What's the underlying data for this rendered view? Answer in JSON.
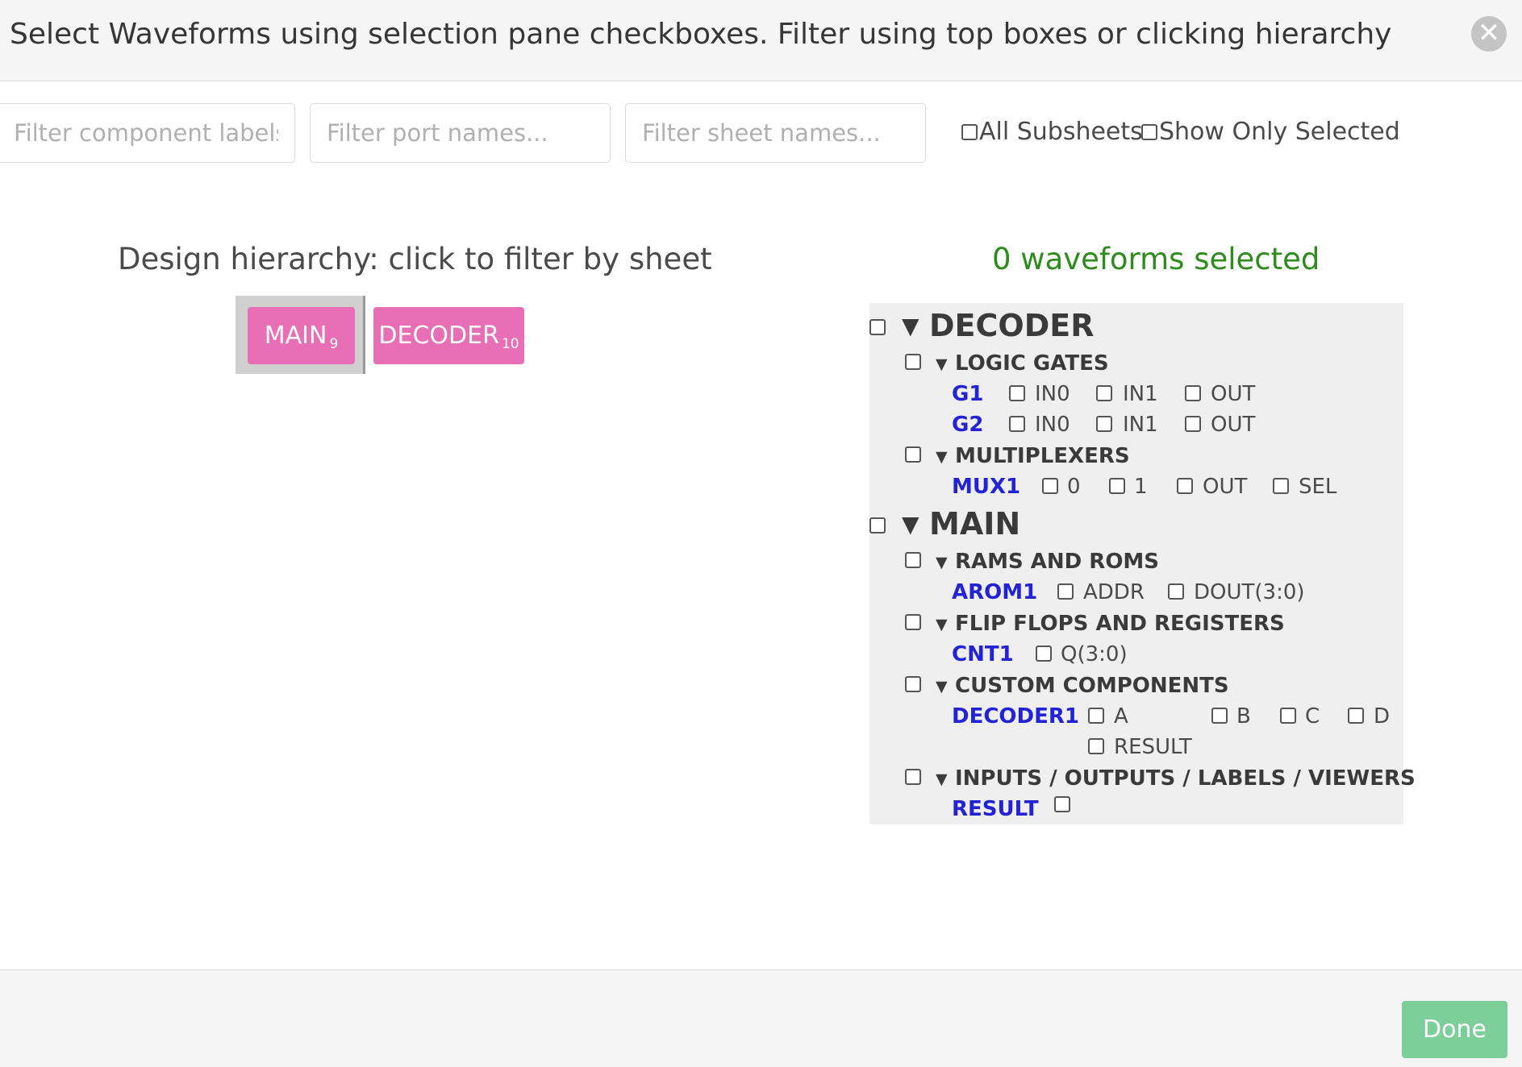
{
  "header": {
    "title": "Select Waveforms using selection pane checkboxes. Filter using top boxes or clicking hierarchy",
    "close_symbol": "✕"
  },
  "filters": {
    "component_placeholder": "Filter component labels...",
    "port_placeholder": "Filter port names...",
    "sheet_placeholder": "Filter sheet names...",
    "all_subsheets_label": "All Subsheets",
    "show_only_selected_label": "Show Only Selected"
  },
  "hierarchy": {
    "title": "Design hierarchy: click to filter by sheet",
    "sheets": [
      {
        "name": "MAIN",
        "count": "9"
      },
      {
        "name": "DECODER",
        "count": "10"
      }
    ]
  },
  "selection": {
    "count_text": "0 waveforms selected",
    "sheets": {
      "decoder": {
        "name": "DECODER",
        "groups": {
          "logic_gates": {
            "label": "LOGIC GATES",
            "components": {
              "g1": {
                "label": "G1",
                "ports": [
                  "IN0",
                  "IN1",
                  "OUT"
                ]
              },
              "g2": {
                "label": "G2",
                "ports": [
                  "IN0",
                  "IN1",
                  "OUT"
                ]
              }
            }
          },
          "multiplexers": {
            "label": "MULTIPLEXERS",
            "components": {
              "mux1": {
                "label": "MUX1",
                "ports": [
                  "0",
                  "1",
                  "OUT",
                  "SEL"
                ]
              }
            }
          }
        }
      },
      "main": {
        "name": "MAIN",
        "groups": {
          "rams_roms": {
            "label": "RAMS AND ROMS",
            "components": {
              "arom1": {
                "label": "AROM1",
                "ports": [
                  "ADDR",
                  "DOUT(3:0)"
                ]
              }
            }
          },
          "flipflops": {
            "label": "FLIP FLOPS AND REGISTERS",
            "components": {
              "cnt1": {
                "label": "CNT1",
                "ports": [
                  "Q(3:0)"
                ]
              }
            }
          },
          "custom": {
            "label": "CUSTOM COMPONENTS",
            "components": {
              "decoder1": {
                "label": "DECODER1",
                "ports": [
                  "A",
                  "B",
                  "C",
                  "D",
                  "RESULT"
                ]
              }
            }
          },
          "io": {
            "label": "INPUTS / OUTPUTS / LABELS / VIEWERS",
            "components": {
              "result": {
                "label": "RESULT",
                "ports": []
              }
            }
          }
        }
      }
    }
  },
  "icons": {
    "expand_triangle": "▼"
  },
  "colors": {
    "sheet_button": "#e86eb6",
    "component_label": "#2323d6",
    "count_text": "#2e8b1e",
    "done_button": "#7dcf9a"
  },
  "footer": {
    "done_label": "Done"
  }
}
